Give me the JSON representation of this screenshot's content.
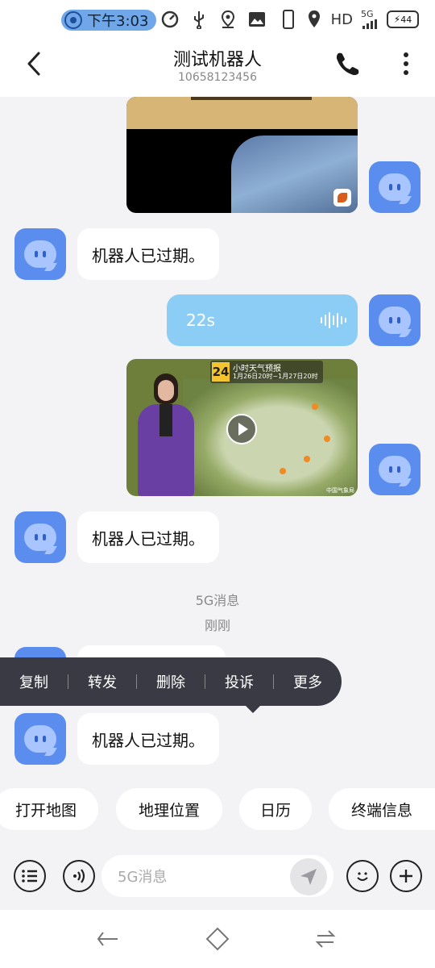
{
  "status_bar": {
    "time": "下午3:03",
    "network_label": "HD",
    "network_type": "5G",
    "battery_level": "44",
    "icons": [
      "notification-icon",
      "speed-icon",
      "usb-icon",
      "location-icon",
      "gallery-icon",
      "phone-icon",
      "location-icon",
      "signal-icon",
      "battery-icon"
    ]
  },
  "header": {
    "title": "测试机器人",
    "subtitle": "10658123456",
    "icons": [
      "back-icon",
      "phone-icon",
      "more-vertical-icon"
    ]
  },
  "messages": [
    {
      "type": "image",
      "side": "right",
      "description_icon": "image-thumbnail"
    },
    {
      "type": "text",
      "side": "left",
      "text": "机器人已过期。"
    },
    {
      "type": "voice",
      "side": "right",
      "duration": "22s",
      "icon": "voice-wave-icon"
    },
    {
      "type": "video",
      "side": "right",
      "overlay_number": "24",
      "overlay_title": "小时天气预报",
      "overlay_subtitle": "1月26日20时~1月27日20时",
      "credit": "中国气象局"
    },
    {
      "type": "text",
      "side": "left",
      "text": "机器人已过期。"
    },
    {
      "type": "system",
      "label": "5G消息",
      "time": "刚刚"
    },
    {
      "type": "text",
      "side": "left",
      "text": "机器人已过期。"
    }
  ],
  "context_menu": {
    "items": [
      "复制",
      "转发",
      "删除",
      "投诉",
      "更多"
    ]
  },
  "suggestion_chips": [
    "打开地图",
    "地理位置",
    "日历",
    "终端信息"
  ],
  "input_bar": {
    "placeholder": "5G消息",
    "icons": [
      "menu-list-icon",
      "voice-input-icon",
      "send-icon",
      "emoji-icon",
      "add-icon"
    ]
  },
  "nav_bar": {
    "icons": [
      "nav-back-icon",
      "nav-home-icon",
      "nav-recents-icon"
    ]
  },
  "colors": {
    "accent": "#5b8def",
    "voice_bubble": "#8ccdf6",
    "background": "#f3f3f5",
    "context_menu": "#3a3a44"
  }
}
